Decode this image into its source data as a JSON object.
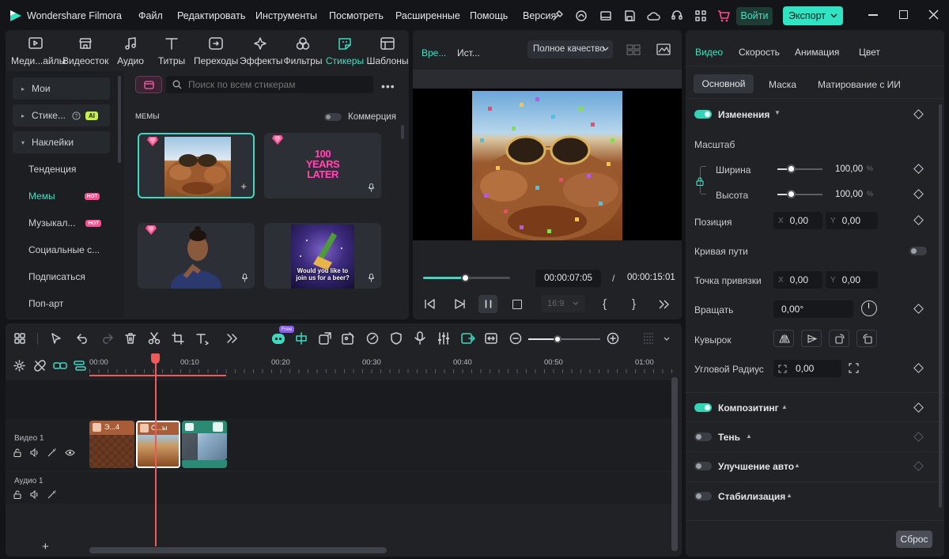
{
  "app": {
    "title": "Wondershare Filmora"
  },
  "menu": [
    "Файл",
    "Редактировать",
    "Инструменты",
    "Посмотреть",
    "Расширенные",
    "Помощь",
    "Версия"
  ],
  "header": {
    "login": "Войти",
    "export": "Экспорт"
  },
  "media_tabs": [
    "Меди...айлы",
    "Видеосток",
    "Аудио",
    "Титры",
    "Переходы",
    "Эффекты",
    "Фильтры",
    "Стикеры",
    "Шаблоны"
  ],
  "sidebar": {
    "items": [
      {
        "label": "Мои"
      },
      {
        "label": "Стике...",
        "badge": "AI"
      },
      {
        "label": "Наклейки"
      },
      {
        "label": "Тенденция"
      },
      {
        "label": "Мемы",
        "badge": "HOT"
      },
      {
        "label": "Музыкал...",
        "badge": "HOT"
      },
      {
        "label": "Социальные с..."
      },
      {
        "label": "Подписаться"
      },
      {
        "label": "Поп-арт"
      }
    ]
  },
  "stickers": {
    "search_placeholder": "Поиск по всем стикерам",
    "section_title": "МЕМЫ",
    "commerce_label": "Коммерция",
    "card_hundred_years": "100 YEARS LATER",
    "card_beer_text": "Would you like to join us for a beer?"
  },
  "preview": {
    "tab_timeline": "Вре...",
    "tab_source": "Ист...",
    "quality": "Полное качество",
    "current_time": "00:00:07:05",
    "separator": "/",
    "total_time": "00:00:15:01",
    "ratio": "16:9",
    "progress": 0.48
  },
  "props": {
    "tabs": [
      "Видео",
      "Скорость",
      "Анимация",
      "Цвет"
    ],
    "subtabs": [
      "Основной",
      "Маска",
      "Матирование с ИИ"
    ],
    "section_changes": "Изменения",
    "scale_label": "Масштаб",
    "width_label": "Ширина",
    "width_value": "100,00",
    "height_label": "Высота",
    "height_value": "100,00",
    "percent": "%",
    "position_label": "Позиция",
    "pos_x": "0,00",
    "pos_y": "0,00",
    "x_prefix": "X",
    "y_prefix": "Y",
    "path_curve_label": "Кривая пути",
    "anchor_label": "Точка привязки",
    "anchor_x": "0,00",
    "anchor_y": "0,00",
    "rotate_label": "Вращать",
    "rotate_value": "0,00°",
    "flip_label": "Кувырок",
    "corner_label": "Угловой Радиус",
    "corner_value": "0,00",
    "section_compositing": "Композитинг",
    "section_shadow": "Тень",
    "section_auto_enhance": "Улучшение авто",
    "section_stabilization": "Стабилизация",
    "reset": "Сброс"
  },
  "timeline": {
    "free_badge": "Free",
    "ruler": [
      "00:00",
      "00:10",
      "00:20",
      "00:30",
      "00:40",
      "00:50",
      "01:00"
    ],
    "video_track": "Видео 1",
    "audio_track": "Аудио 1",
    "clip1": "Э...4",
    "clip2": "С...ы"
  },
  "colors": {
    "accent": "#2fe3c3",
    "playhead": "#f0595a",
    "hot": "#ff4d8d",
    "ai": "#c8f04a"
  }
}
